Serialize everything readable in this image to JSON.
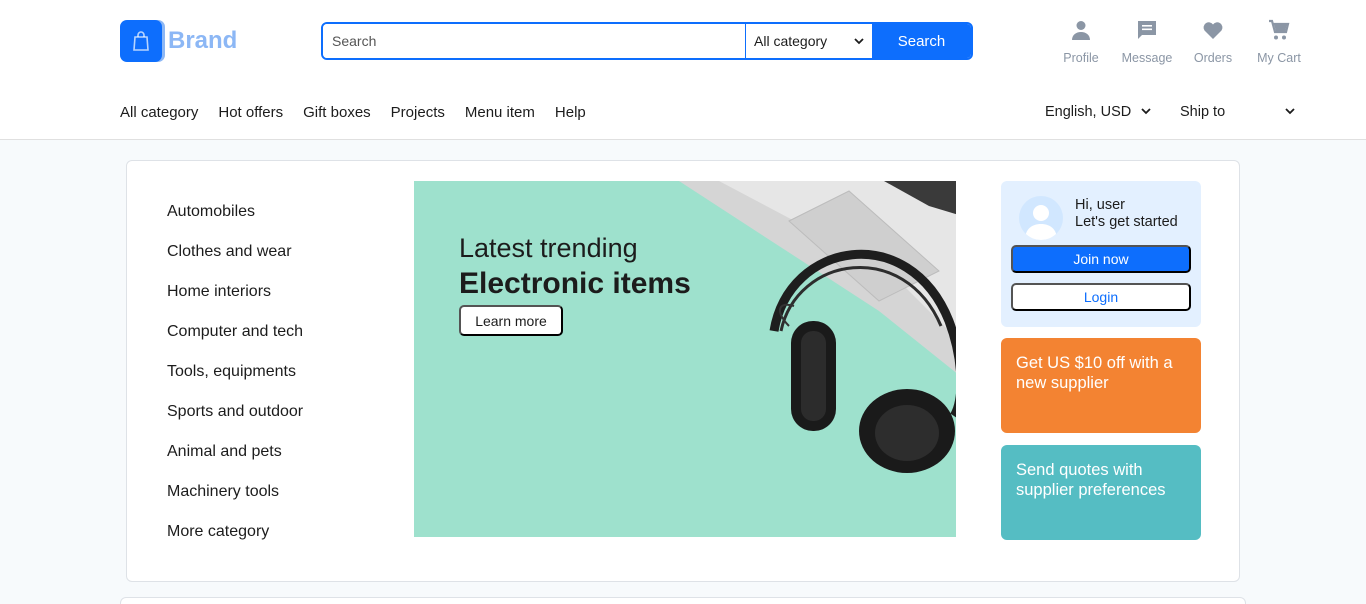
{
  "brand": {
    "name": "Brand"
  },
  "search": {
    "placeholder": "Search",
    "category": "All category",
    "button": "Search"
  },
  "actions": [
    {
      "label": "Profile",
      "icon": "person-icon"
    },
    {
      "label": "Message",
      "icon": "message-icon"
    },
    {
      "label": "Orders",
      "icon": "heart-icon"
    },
    {
      "label": "My Cart",
      "icon": "cart-icon"
    }
  ],
  "nav": {
    "items": [
      "All category",
      "Hot offers",
      "Gift boxes",
      "Projects",
      "Menu item",
      "Help"
    ],
    "language": "English, USD",
    "ship": "Ship to"
  },
  "categories": [
    "Automobiles",
    "Clothes and wear",
    "Home interiors",
    "Computer and tech",
    "Tools, equipments",
    "Sports and outdoor",
    "Animal and pets",
    "Machinery tools",
    "More category"
  ],
  "banner": {
    "subtitle": "Latest trending",
    "title": "Electronic items",
    "button": "Learn more"
  },
  "user": {
    "greeting": "Hi, user",
    "tagline": "Let's get started",
    "join": "Join now",
    "login": "Login"
  },
  "promos": {
    "supplier": "Get US $10 off with a new supplier",
    "quotes": "Send quotes with supplier preferences"
  },
  "colors": {
    "primary": "#0d6efd",
    "orange": "#f38332",
    "teal": "#55bdc3",
    "banner": "#9ee1cd"
  }
}
